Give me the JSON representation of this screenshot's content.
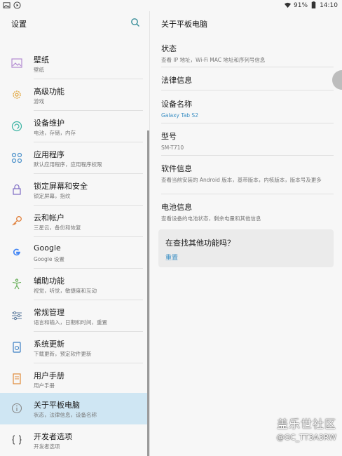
{
  "status_bar": {
    "battery": "91%",
    "time": "14:10"
  },
  "left": {
    "title": "设置",
    "items": [
      {
        "icon": "wallpaper-icon",
        "title": "壁纸",
        "subtitle": "壁纸"
      },
      {
        "icon": "advanced-features-icon",
        "title": "高级功能",
        "subtitle": "游戏"
      },
      {
        "icon": "device-maintenance-icon",
        "title": "设备维护",
        "subtitle": "电池，存储，内存"
      },
      {
        "icon": "apps-icon",
        "title": "应用程序",
        "subtitle": "默认应用程序，应用程序权限"
      },
      {
        "icon": "lock-icon",
        "title": "锁定屏幕和安全",
        "subtitle": "锁定屏幕，指纹"
      },
      {
        "icon": "key-icon",
        "title": "云和帐户",
        "subtitle": "三星云，备份和恢复"
      },
      {
        "icon": "google-icon",
        "title": "Google",
        "subtitle": "Google 设置"
      },
      {
        "icon": "accessibility-icon",
        "title": "辅助功能",
        "subtitle": "视觉，听觉，敏捷度和互动"
      },
      {
        "icon": "general-management-icon",
        "title": "常规管理",
        "subtitle": "语言和输入，日期和时间，重置"
      },
      {
        "icon": "software-update-icon",
        "title": "系统更新",
        "subtitle": "下载更新，预定软件更新"
      },
      {
        "icon": "user-manual-icon",
        "title": "用户手册",
        "subtitle": "用户手册"
      },
      {
        "icon": "info-icon",
        "title": "关于平板电脑",
        "subtitle": "状态，法律信息，设备名称"
      },
      {
        "icon": "developer-options-icon",
        "title": "开发者选项",
        "subtitle": "开发者选项"
      }
    ]
  },
  "right": {
    "title": "关于平板电脑",
    "items": [
      {
        "title": "状态",
        "subtitle": "查看 IP 地址，Wi-Fi MAC 地址和序列号信息"
      },
      {
        "title": "法律信息",
        "subtitle": ""
      },
      {
        "title": "设备名称",
        "subtitle": "Galaxy Tab S2"
      },
      {
        "title": "型号",
        "subtitle": "SM-T710"
      },
      {
        "title": "软件信息",
        "subtitle": "查看当前安装的 Android 版本，基带版本，内核版本，版本号及更多"
      },
      {
        "title": "电池信息",
        "subtitle": "查看设备的电池状态，剩余电量和其他信息"
      }
    ],
    "card": {
      "question": "在查找其他功能吗？",
      "link": "重置"
    }
  },
  "watermark": {
    "line1": "盖乐世社区",
    "line2": "@GC_TT3A3RW"
  },
  "colors": {
    "accent": "#3b8fc4",
    "selected_bg": "#cfe6f3"
  }
}
